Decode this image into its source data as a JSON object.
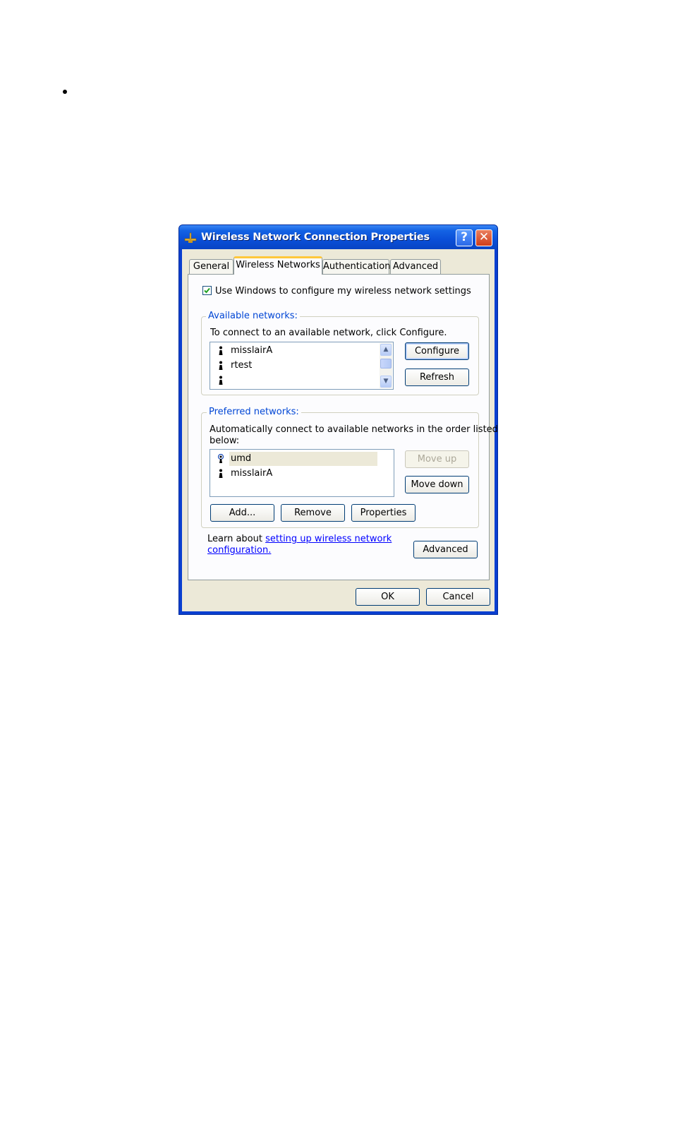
{
  "window": {
    "title": "Wireless Network Connection Properties",
    "help_label": "?",
    "close_label": "✕"
  },
  "tabs": [
    {
      "label": "General",
      "active": false
    },
    {
      "label": "Wireless Networks",
      "active": true
    },
    {
      "label": "Authentication",
      "active": false
    },
    {
      "label": "Advanced",
      "active": false
    }
  ],
  "use_windows": {
    "label": "Use Windows to configure my wireless network settings",
    "checked": true
  },
  "available": {
    "title": "Available networks:",
    "instruction": "To connect to an available network, click Configure.",
    "items": [
      {
        "name": "misslairA",
        "icon": "wireless-antenna-icon"
      },
      {
        "name": "rtest",
        "icon": "wireless-antenna-icon"
      },
      {
        "name": "",
        "icon": "wireless-antenna-icon"
      }
    ],
    "configure_label": "Configure",
    "refresh_label": "Refresh"
  },
  "preferred": {
    "title": "Preferred networks:",
    "instruction_1": "Automatically connect to available networks in the order listed",
    "instruction_2": "below:",
    "items": [
      {
        "name": "umd",
        "icon": "connected-antenna-icon",
        "selected": true
      },
      {
        "name": "misslairA",
        "icon": "wireless-antenna-icon",
        "selected": false
      }
    ],
    "move_up_label": "Move up",
    "move_down_label": "Move down",
    "add_label": "Add...",
    "remove_label": "Remove",
    "properties_label": "Properties"
  },
  "learn": {
    "prefix": "Learn about ",
    "link_1": "setting up wireless network",
    "link_2": "configuration.",
    "advanced_label": "Advanced"
  },
  "footer": {
    "ok_label": "OK",
    "cancel_label": "Cancel"
  },
  "colors": {
    "titlebar": "#0a4fd8",
    "dialog_face": "#ece9d8",
    "group_title": "#0046d5",
    "selection": "#ece9d8",
    "link": "#0000ff"
  }
}
